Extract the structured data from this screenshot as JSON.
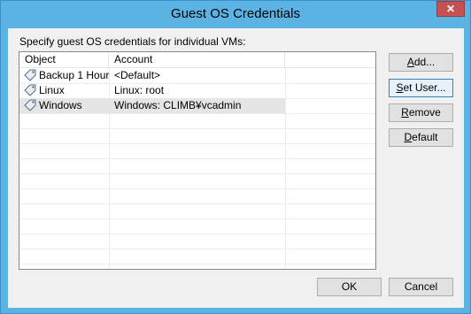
{
  "window": {
    "title": "Guest OS Credentials",
    "close_glyph": "✕"
  },
  "instruction": "Specify guest OS credentials for individual VMs:",
  "table": {
    "columns": [
      "Object",
      "Account"
    ],
    "rows": [
      {
        "object": "Backup 1 Hour",
        "account": "<Default>",
        "icon": "tag-icon"
      },
      {
        "object": "Linux",
        "account": "Linux: root",
        "icon": "tag-icon"
      },
      {
        "object": "Windows",
        "account": "Windows: CLIMB¥vcadmin",
        "icon": "tag-icon",
        "selected": true
      }
    ]
  },
  "buttons": {
    "add": {
      "mnemonic": "A",
      "rest": "dd..."
    },
    "set_user": {
      "mnemonic": "S",
      "rest": "et User..."
    },
    "remove": {
      "mnemonic": "R",
      "rest": "emove"
    },
    "default": {
      "mnemonic": "D",
      "rest": "efault"
    },
    "ok": "OK",
    "cancel": "Cancel"
  }
}
